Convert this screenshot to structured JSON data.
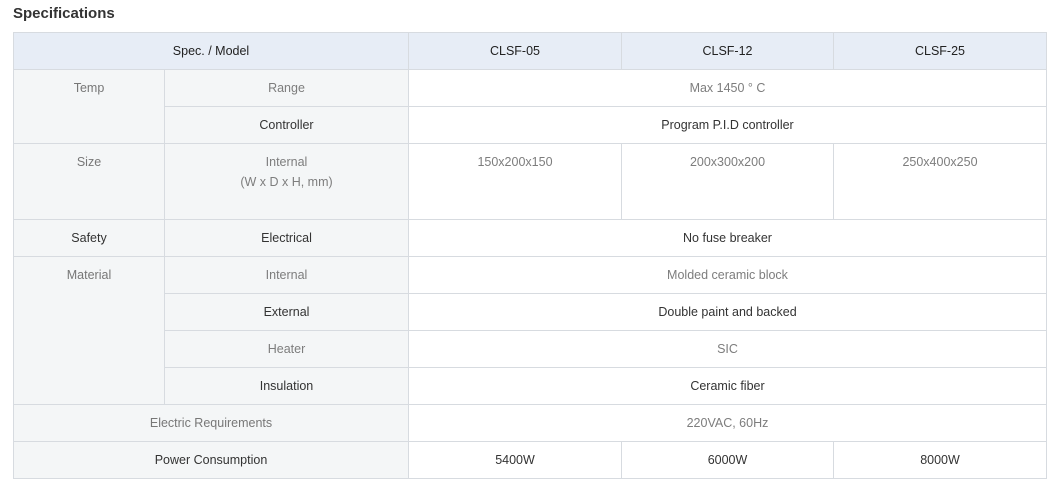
{
  "title": "Specifications",
  "header": {
    "spec_model": "Spec. / Model",
    "models": [
      "CLSF-05",
      "CLSF-12",
      "CLSF-25"
    ]
  },
  "rows": {
    "temp": {
      "category": "Temp",
      "range_label": "Range",
      "range_value": "Max 1450 ° C",
      "controller_label": "Controller",
      "controller_value": "Program P.I.D controller"
    },
    "size": {
      "category": "Size",
      "internal_label": "Internal",
      "internal_unit": "(W x D x H, mm)",
      "values": [
        "150x200x150",
        "200x300x200",
        "250x400x250"
      ]
    },
    "safety": {
      "category": "Safety",
      "electrical_label": "Electrical",
      "electrical_value": "No fuse breaker"
    },
    "material": {
      "category": "Material",
      "internal_label": "Internal",
      "internal_value": "Molded ceramic block",
      "external_label": "External",
      "external_value": "Double paint and backed",
      "heater_label": "Heater",
      "heater_value": "SIC",
      "insulation_label": "Insulation",
      "insulation_value": "Ceramic fiber"
    },
    "electric": {
      "label": "Electric Requirements",
      "value": "220VAC, 60Hz"
    },
    "power": {
      "label": "Power Consumption",
      "values": [
        "5400W",
        "6000W",
        "8000W"
      ]
    }
  },
  "colors": {
    "header_bg": "#e7edf6",
    "label_bg": "#f4f6f7",
    "border": "#d7dbe0",
    "dark_text": "#333333",
    "light_text": "#7d7d7d"
  }
}
